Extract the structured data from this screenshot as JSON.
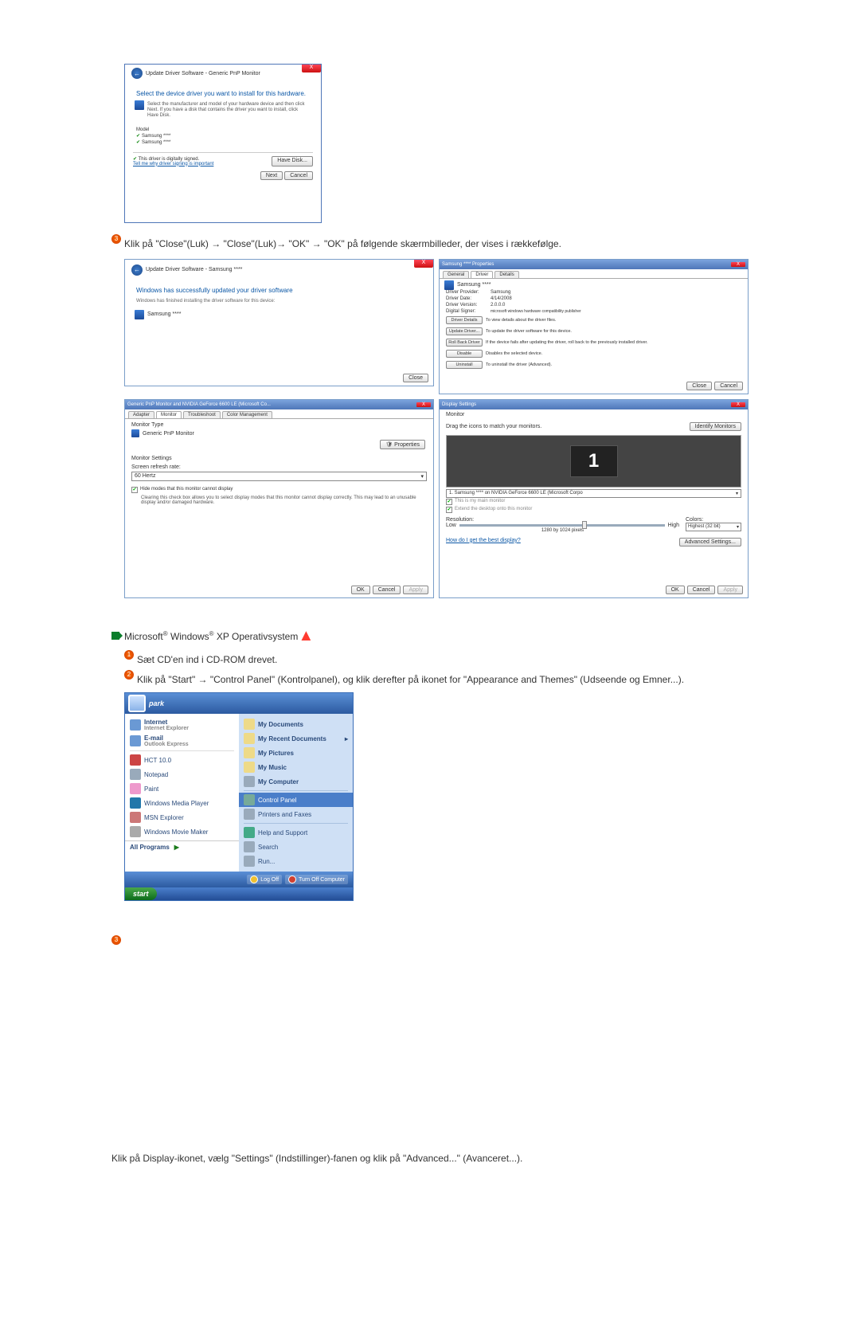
{
  "vistaUpdate1": {
    "breadcrumb": "Update Driver Software - Generic PnP Monitor",
    "heading": "Select the device driver you want to install for this hardware.",
    "instruction": "Select the manufacturer and model of your hardware device and then click Next. If you have a disk that contains the driver you want to install, click Have Disk.",
    "modelLabel": "Model",
    "model1": "Samsung ****",
    "model2": "Samsung ****",
    "signedText": "This driver is digitally signed.",
    "signedLink": "Tell me why driver signing is important",
    "haveDisk": "Have Disk...",
    "next": "Next",
    "cancel": "Cancel"
  },
  "step3": {
    "num": "3",
    "text": "Klik på \"Close\"(Luk) → \"Close\"(Luk)→ \"OK\" → \"OK\" på følgende skærmbilleder, der vises i rækkefølge."
  },
  "gridA": {
    "breadcrumb": "Update Driver Software - Samsung ****",
    "heading": "Windows has successfully updated your driver software",
    "sub": "Windows has finished installing the driver software for this device:",
    "device": "Samsung ****",
    "close": "Close"
  },
  "gridB": {
    "title": "Samsung **** Properties",
    "tabs": {
      "general": "General",
      "driver": "Driver",
      "details": "Details"
    },
    "device": "Samsung ****",
    "provider": {
      "lbl": "Driver Provider:",
      "val": "Samsung"
    },
    "date": {
      "lbl": "Driver Date:",
      "val": "4/14/2008"
    },
    "version": {
      "lbl": "Driver Version:",
      "val": "2.0.0.0"
    },
    "signer": {
      "lbl": "Digital Signer:",
      "val": "microsoft windows hardware compatibility publisher"
    },
    "btnDetails": {
      "b": "Driver Details",
      "d": "To view details about the driver files."
    },
    "btnUpdate": {
      "b": "Update Driver...",
      "d": "To update the driver software for this device."
    },
    "btnRoll": {
      "b": "Roll Back Driver",
      "d": "If the device fails after updating the driver, roll back to the previously installed driver."
    },
    "btnDisable": {
      "b": "Disable",
      "d": "Disables the selected device."
    },
    "btnUninstall": {
      "b": "Uninstall",
      "d": "To uninstall the driver (Advanced)."
    },
    "close": "Close",
    "cancel": "Cancel"
  },
  "gridC": {
    "title": "Generic PnP Monitor and NVIDIA GeForce 6600 LE (Microsoft Co...",
    "tabs": {
      "adapter": "Adapter",
      "monitor": "Monitor",
      "trouble": "Troubleshoot",
      "color": "Color Management"
    },
    "typeLabel": "Monitor Type",
    "typeValue": "Generic PnP Monitor",
    "propsBtn": "Properties",
    "settingsLabel": "Monitor Settings",
    "refreshLabel": "Screen refresh rate:",
    "refreshValue": "60 Hertz",
    "hideCheck": "Hide modes that this monitor cannot display",
    "hideDesc": "Clearing this check box allows you to select display modes that this monitor cannot display correctly. This may lead to an unusable display and/or damaged hardware.",
    "ok": "OK",
    "cancel": "Cancel",
    "apply": "Apply"
  },
  "gridD": {
    "title": "Display Settings",
    "monitorLabel": "Monitor",
    "dragText": "Drag the icons to match your monitors.",
    "identify": "Identify Monitors",
    "previewNum": "1",
    "select": "1. Samsung **** on NVIDIA GeForce 6600 LE (Microsoft Corpo",
    "mainCheck": "This is my main monitor",
    "extendCheck": "Extend the desktop onto this monitor",
    "resLabel": "Resolution:",
    "resLow": "Low",
    "resHigh": "High",
    "resValue": "1280 by 1024 pixels",
    "colorsLabel": "Colors:",
    "colorsValue": "Highest (32 bit)",
    "bestLink": "How do I get the best display?",
    "advanced": "Advanced Settings...",
    "ok": "OK",
    "cancel": "Cancel",
    "apply": "Apply"
  },
  "xpHeader": {
    "ms": "Microsoft",
    "win": "Windows",
    "rest": "XP Operativsystem"
  },
  "xpStep1": {
    "num": "1",
    "text": "Sæt CD'en ind i CD-ROM drevet."
  },
  "xpStep2": {
    "num": "2",
    "text": "Klik på \"Start\" → \"Control Panel\" (Kontrolpanel), og klik derefter på ikonet for \"Appearance and Themes\" (Udseende og Emner...)."
  },
  "startMenu": {
    "user": "park",
    "left": {
      "internet": "Internet",
      "internetSub": "Internet Explorer",
      "email": "E-mail",
      "emailSub": "Outlook Express",
      "hct": "HCT 10.0",
      "notepad": "Notepad",
      "paint": "Paint",
      "wmp": "Windows Media Player",
      "msn": "MSN Explorer",
      "wmm": "Windows Movie Maker",
      "allPrograms": "All Programs"
    },
    "right": {
      "myDocs": "My Documents",
      "recent": "My Recent Documents",
      "pics": "My Pictures",
      "music": "My Music",
      "comp": "My Computer",
      "cpanel": "Control Panel",
      "printers": "Printers and Faxes",
      "help": "Help and Support",
      "search": "Search",
      "run": "Run..."
    },
    "logoff": "Log Off",
    "turnoff": "Turn Off Computer",
    "startBtn": "start"
  },
  "xpStep3Num": "3",
  "finalStep": "Klik på Display-ikonet, vælg \"Settings\" (Indstillinger)-fanen og klik på \"Advanced...\" (Avanceret...)."
}
